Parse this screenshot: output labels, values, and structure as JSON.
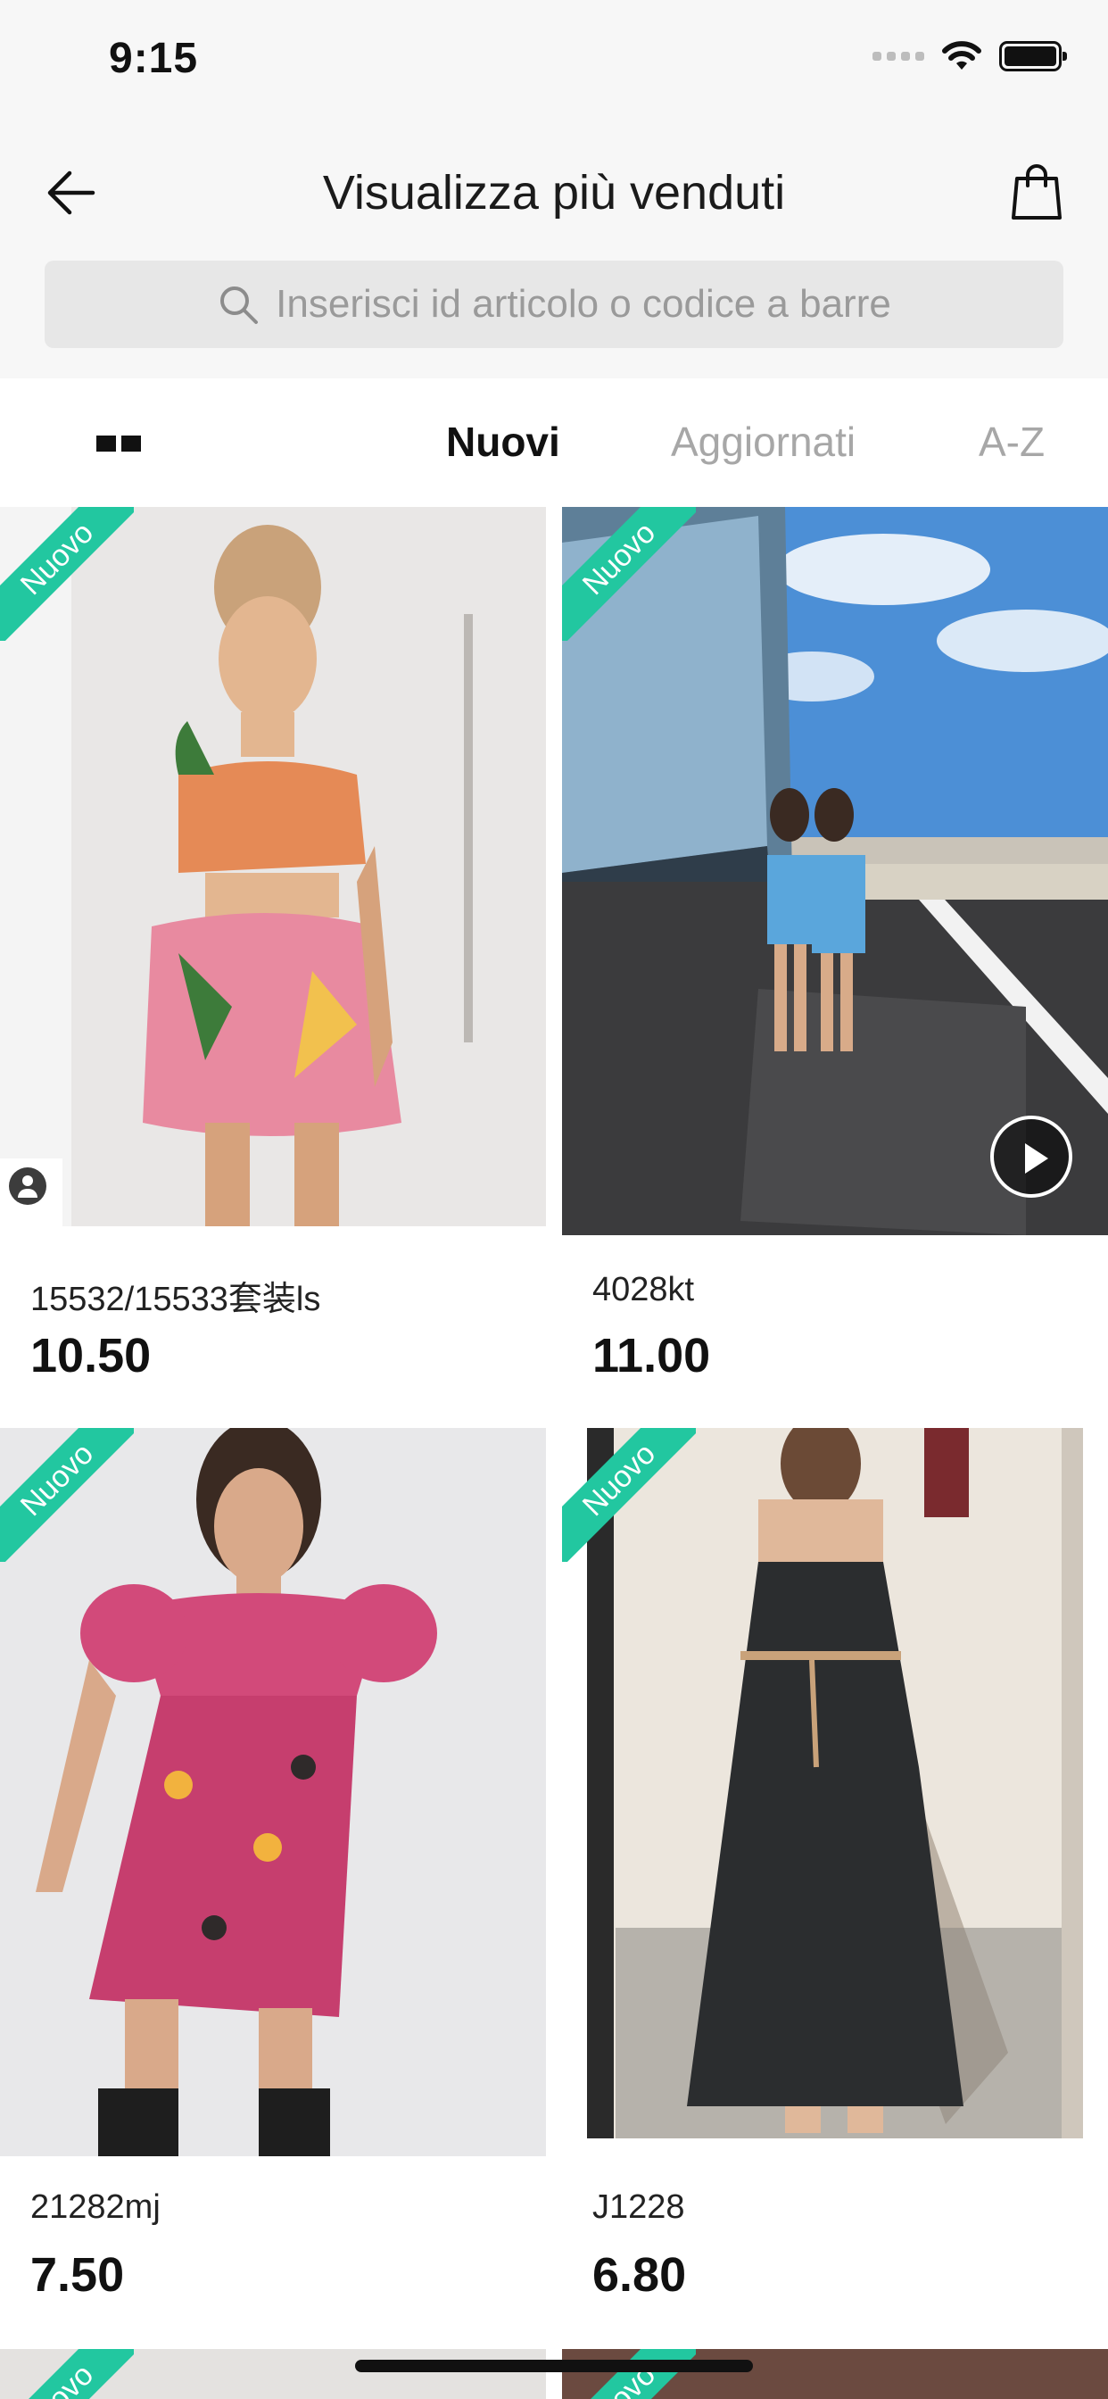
{
  "status_bar": {
    "time": "9:15"
  },
  "header": {
    "title": "Visualizza più venduti",
    "back_icon": "arrow-left-icon",
    "bag_icon": "shopping-bag-icon"
  },
  "search": {
    "placeholder": "Inserisci id articolo o codice a barre",
    "icon": "search-icon"
  },
  "tabs": {
    "layout_toggle_icon": "grid-toggle-icon",
    "items": [
      {
        "label": "Nuovi",
        "active": true
      },
      {
        "label": "Aggiornati",
        "active": false
      },
      {
        "label": "A-Z",
        "active": false
      }
    ]
  },
  "products": [
    {
      "badge": "Nuovo",
      "code": "15532/15533套装ls",
      "price": "10.50"
    },
    {
      "badge": "Nuovo",
      "code": "4028kt",
      "price": "11.00"
    },
    {
      "badge": "Nuovo",
      "code": "21282mj",
      "price": "7.50"
    },
    {
      "badge": "Nuovo",
      "code": "J1228",
      "price": "6.80"
    },
    {
      "badge": "Nuovo"
    },
    {
      "badge": "Nuovo"
    }
  ],
  "colors": {
    "accent": "#22c7a0",
    "background": "#f7f7f7"
  }
}
